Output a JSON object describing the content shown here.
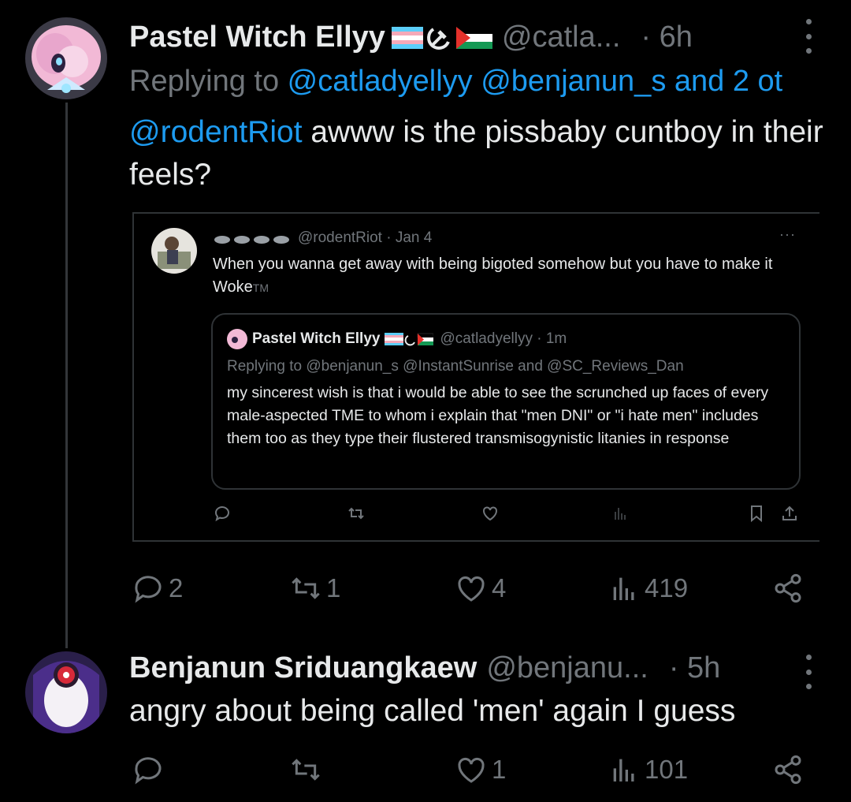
{
  "tweet1": {
    "display_name": "Pastel Witch Ellyy",
    "handle": "@catla...",
    "time": "· 6h",
    "replying_prefix": "Replying to ",
    "replying_handles": "@catladyellyy @benjanun_s and 2 ot",
    "mention": "@rodentRiot",
    "text": " awww is the pissbaby cuntboy in their feels?",
    "actions": {
      "replies": "2",
      "reposts": "1",
      "likes": "4",
      "views": "419"
    }
  },
  "quoted_screenshot": {
    "handle_time": "@rodentRiot · Jan 4",
    "text": "When you wanna get away with being bigoted somehow but you have to make it Woke",
    "tm": "TM",
    "inner": {
      "display_name": "Pastel Witch Ellyy",
      "handle_time": "@catladyellyy · 1m",
      "replying": "Replying to @benjanun_s @InstantSunrise and @SC_Reviews_Dan",
      "text": "my sincerest wish is that i would be able to see the scrunched up faces of every male-aspected TME to whom i explain that \"men DNI\" or \"i hate men\" includes them too as they type their flustered transmisogynistic litanies in response"
    },
    "more": "···"
  },
  "tweet2": {
    "display_name": "Benjanun Sriduangkaew",
    "handle": "@benjanu...",
    "time": "· 5h",
    "text": "angry about being called 'men' again I guess",
    "actions": {
      "replies": "",
      "reposts": "",
      "likes": "1",
      "views": "101"
    }
  },
  "icons": [
    "reply-icon",
    "repost-icon",
    "like-icon",
    "views-icon",
    "share-icon",
    "bookmark-icon",
    "more-icon"
  ],
  "colors": {
    "background": "#000000",
    "text": "#e7e9ea",
    "muted": "#71767b",
    "link": "#1d9bf0",
    "border": "#2f3336"
  }
}
